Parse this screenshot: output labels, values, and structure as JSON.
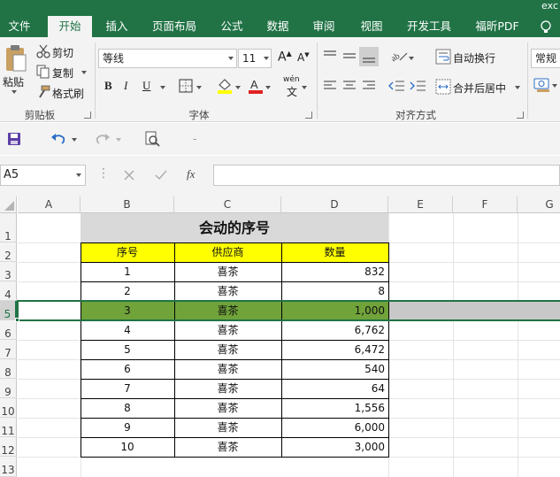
{
  "app": {
    "title_fragment": "exc"
  },
  "ribbon_tabs": [
    {
      "label": "文件",
      "active": false
    },
    {
      "label": "开始",
      "active": true
    },
    {
      "label": "插入",
      "active": false
    },
    {
      "label": "页面布局",
      "active": false
    },
    {
      "label": "公式",
      "active": false
    },
    {
      "label": "数据",
      "active": false
    },
    {
      "label": "审阅",
      "active": false
    },
    {
      "label": "视图",
      "active": false
    },
    {
      "label": "开发工具",
      "active": false
    },
    {
      "label": "福昕PDF",
      "active": false
    }
  ],
  "clipboard": {
    "paste": "粘贴",
    "cut": "剪切",
    "copy": "复制",
    "format_painter": "格式刷",
    "group_label": "剪贴板"
  },
  "font": {
    "family": "等线",
    "size": "11",
    "bold": "B",
    "italic": "I",
    "underline": "U",
    "phonetic": "wén",
    "group_label": "字体"
  },
  "alignment": {
    "wrap_text": "自动换行",
    "merge_center": "合并后居中",
    "group_label": "对齐方式"
  },
  "number": {
    "format": "常规"
  },
  "formula_bar": {
    "name_box": "A5",
    "fx": "fx",
    "value": ""
  },
  "sheet": {
    "columns": [
      "A",
      "B",
      "C",
      "D",
      "E",
      "F",
      "G"
    ],
    "rows": [
      "1",
      "2",
      "3",
      "4",
      "5",
      "6",
      "7",
      "8",
      "9",
      "10",
      "11",
      "12",
      "13"
    ],
    "selected_row": "5",
    "table_title": "会动的序号",
    "headers": [
      "序号",
      "供应商",
      "数量"
    ],
    "data": [
      {
        "seq": "1",
        "vendor": "喜茶",
        "qty": "832"
      },
      {
        "seq": "2",
        "vendor": "喜茶",
        "qty": "8"
      },
      {
        "seq": "3",
        "vendor": "喜茶",
        "qty": "1,000"
      },
      {
        "seq": "4",
        "vendor": "喜茶",
        "qty": "6,762"
      },
      {
        "seq": "5",
        "vendor": "喜茶",
        "qty": "6,472"
      },
      {
        "seq": "6",
        "vendor": "喜茶",
        "qty": "540"
      },
      {
        "seq": "7",
        "vendor": "喜茶",
        "qty": "64"
      },
      {
        "seq": "8",
        "vendor": "喜茶",
        "qty": "1,556"
      },
      {
        "seq": "9",
        "vendor": "喜茶",
        "qty": "6,000"
      },
      {
        "seq": "10",
        "vendor": "喜茶",
        "qty": "3,000"
      }
    ]
  },
  "colors": {
    "brand": "#217346",
    "title_fill": "#d9d9d9",
    "header_fill": "#ffff00",
    "highlight_fill": "#70a33a",
    "selection_fill": "#c8c8c8",
    "font_color_bar": "#e02020",
    "fill_color_bar": "#ffff00"
  }
}
